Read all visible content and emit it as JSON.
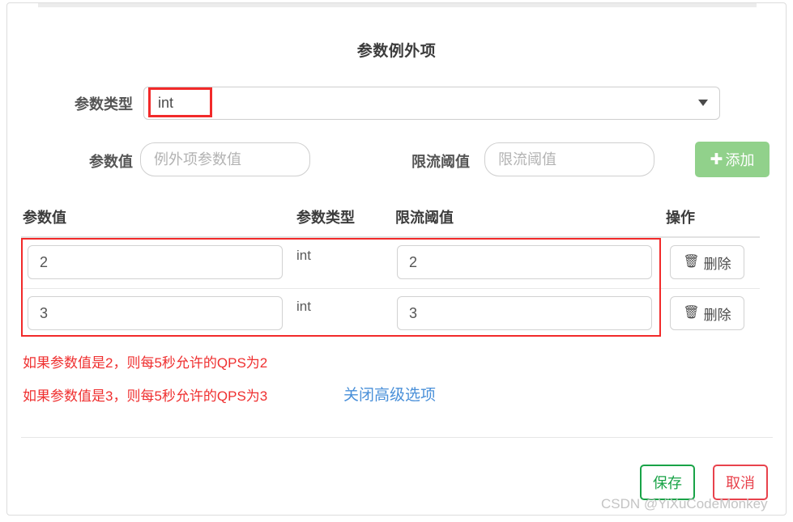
{
  "dialog": {
    "title": "参数例外项"
  },
  "form": {
    "param_type_label": "参数类型",
    "param_type_value": "int",
    "param_value_label": "参数值",
    "param_value_placeholder": "例外项参数值",
    "threshold_label": "限流阈值",
    "threshold_placeholder": "限流阈值",
    "add_button_label": "添加",
    "add_button_icon": "plus-icon",
    "caret_icon": "chevron-down-icon",
    "add_button_color": "#91d18b"
  },
  "table": {
    "headers": {
      "value": "参数值",
      "type": "参数类型",
      "threshold": "限流阈值",
      "operation": "操作"
    },
    "rows": [
      {
        "value": "2",
        "type": "int",
        "threshold": "2",
        "delete_label": "删除",
        "delete_icon": "trash-icon"
      },
      {
        "value": "3",
        "type": "int",
        "threshold": "3",
        "delete_label": "删除",
        "delete_icon": "trash-icon"
      }
    ],
    "highlight_color": "#f22a2a"
  },
  "hints": {
    "line1": "如果参数值是2，则每5秒允许的QPS为2",
    "line2": "如果参数值是3，则每5秒允许的QPS为3",
    "color": "#ef2f2f"
  },
  "advanced_link": {
    "label": "关闭高级选项",
    "color": "#4a90d9"
  },
  "footer": {
    "save_label": "保存",
    "cancel_label": "取消",
    "save_color": "#19a347",
    "cancel_color": "#e8424c"
  },
  "watermark": {
    "text": "CSDN @YiXuCodeMonkey"
  }
}
